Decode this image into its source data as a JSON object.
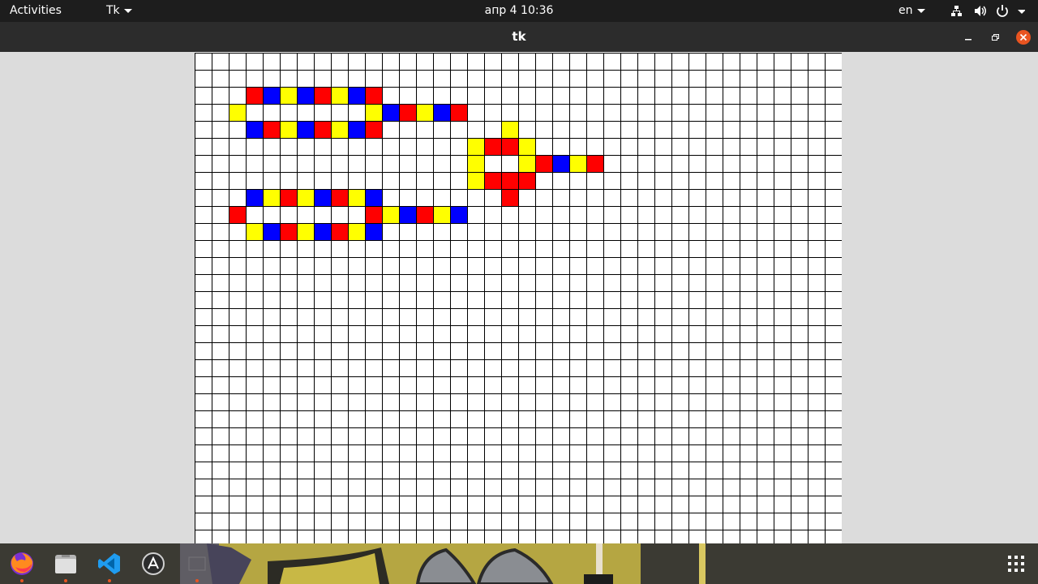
{
  "topbar": {
    "activities": "Activities",
    "app_menu": "Tk",
    "datetime": "апр 4  10:36",
    "keyboard_layout": "en"
  },
  "window": {
    "title": "tk"
  },
  "grid": {
    "columns": 38,
    "rows": 29,
    "colors": {
      "R": "#ff0000",
      "B": "#0000ff",
      "Y": "#ffff00",
      "background": "#ffffff",
      "gridline": "#000000"
    },
    "filled_rows": [
      "",
      "",
      "...RBYBRYBR",
      "..Y.......YBRYBR",
      "...BRYBRYBR.......Y",
      "................YRRY",
      "................Y..YRBYR",
      "................YRRR",
      "...BYRYBRYB.......R",
      "..R.......RYBRYB",
      "...YBRYBRYB"
    ]
  },
  "dock": {
    "apps": [
      {
        "name": "Firefox",
        "icon": "firefox-icon",
        "running": true
      },
      {
        "name": "Files",
        "icon": "files-icon",
        "running": true
      },
      {
        "name": "Visual Studio Code",
        "icon": "vscode-icon",
        "running": true
      },
      {
        "name": "Ubuntu Software",
        "icon": "software-center-icon",
        "running": false
      },
      {
        "name": "Tk",
        "icon": "tk-window-icon",
        "running": true
      }
    ],
    "show_apps_icon": "app-grid-icon"
  }
}
